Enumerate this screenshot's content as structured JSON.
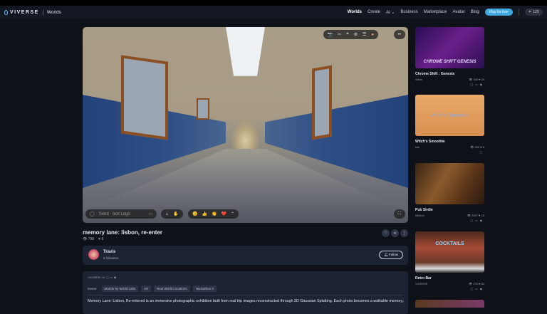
{
  "header": {
    "brand": "VIVERSE",
    "section": "Worlds",
    "nav": [
      "Worlds",
      "Create",
      "AI ⌄",
      "Business",
      "Marketplace",
      "Avatar",
      "Blog"
    ],
    "play_button": "Play for free",
    "points": "125",
    "accent": "#3fa9e0"
  },
  "viewer": {
    "chat_placeholder": "Send · text Logo",
    "toolbar_icons": [
      "camera-icon",
      "tools-icon",
      "controller-icon",
      "settings-icon",
      "menu-icon",
      "avatar-icon",
      "more-icon"
    ],
    "reactions": [
      "😊",
      "👍",
      "👏",
      "❤️",
      "⌃"
    ]
  },
  "world": {
    "title": "memory lane: lisbon, re-enter",
    "views": "798",
    "likes": "8"
  },
  "creator": {
    "name": "Travis",
    "followers": "6 followers",
    "follow_label": "Follow"
  },
  "info": {
    "available_on": "Available on",
    "genre_label": "Genre",
    "tags": [
      "Marble by World Labs",
      "Art",
      "Real World Locations",
      "Hackathon II"
    ],
    "description": "Memory Lane: Lisbon, Re-entered is an immersive photographic exhibition built from real trip images reconstructed through 3D Gaussian Splatting. Each photo becomes a walkable memory,"
  },
  "sidebar": [
    {
      "title": "Chrome Shift : Genesis",
      "author": "Strive",
      "views": "34k",
      "likes": "24",
      "banner": "CHROME SHIFT GENESIS"
    },
    {
      "title": "Witch's Smoothie",
      "author": "kim",
      "views": "400",
      "likes": "6",
      "banner": "Witch's Smoothie"
    },
    {
      "title": "Pub Sirdie",
      "author": "Mikkoh",
      "views": "2557",
      "likes": "16",
      "banner": ""
    },
    {
      "title": "Retro Bar",
      "author": "VIVERSE",
      "views": "276",
      "likes": "83",
      "banner": "COCKTAILS"
    }
  ]
}
